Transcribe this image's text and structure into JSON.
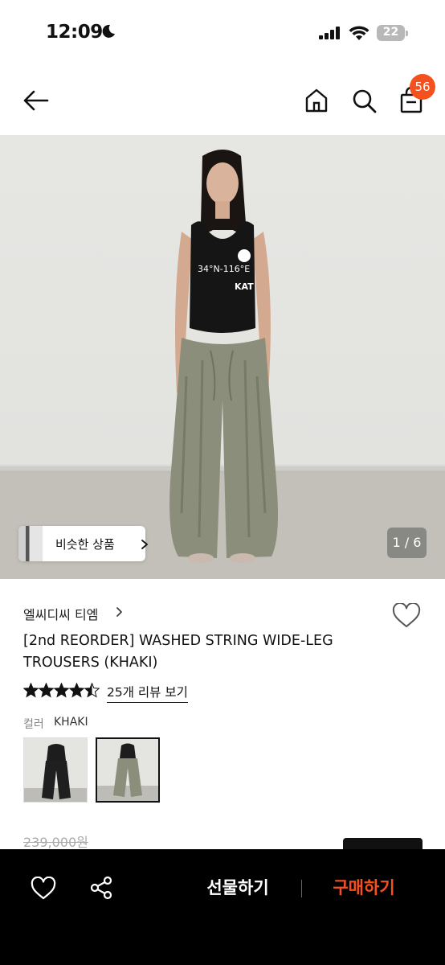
{
  "status_bar": {
    "time": "12:09",
    "battery": "22"
  },
  "header": {
    "cart_count": "56",
    "icons": [
      "back-arrow-icon",
      "home-icon",
      "search-icon",
      "shopping-bag-icon"
    ]
  },
  "gallery": {
    "similar_button_label": "비슷한 상품",
    "page_indicator": "1 / 6",
    "print_text_top": "34°N-116°E",
    "print_text_bottom": "KAT"
  },
  "product": {
    "brand": "엘씨디씨 티엠",
    "title": "[2nd REORDER] WASHED STRING WIDE-LEG TROUSERS (KHAKI)",
    "rating": 4.5,
    "review_link": "25개 리뷰 보기",
    "color_label": "컬러",
    "color_value": "KHAKI",
    "original_price": "239,000원"
  },
  "bottom_bar": {
    "gift_label": "선물하기",
    "buy_label": "구매하기",
    "accent_color": "#f4511e"
  }
}
